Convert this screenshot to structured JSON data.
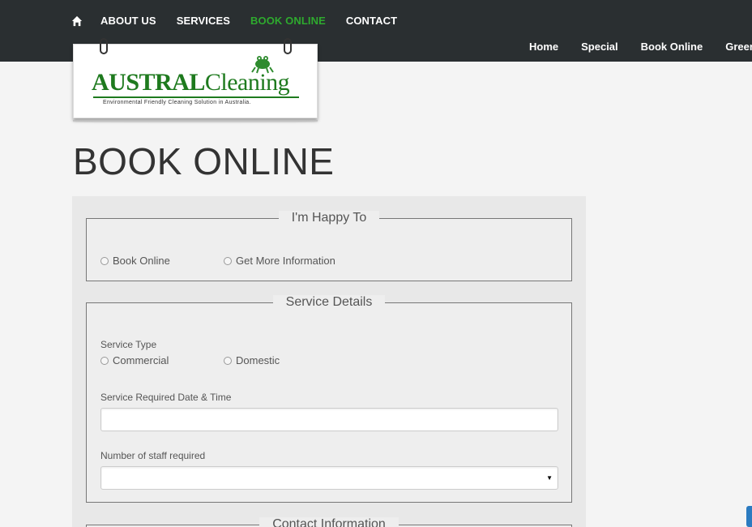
{
  "main_nav": {
    "items": [
      {
        "label": "ABOUT US",
        "active": false
      },
      {
        "label": "SERVICES",
        "active": false
      },
      {
        "label": "BOOK ONLINE",
        "active": true
      },
      {
        "label": "CONTACT",
        "active": false
      }
    ],
    "home_icon": "home-icon"
  },
  "sub_nav": {
    "items": [
      {
        "label": "Home"
      },
      {
        "label": "Special"
      },
      {
        "label": "Book Online"
      },
      {
        "label": "Green"
      }
    ]
  },
  "logo": {
    "brand_bold": "AUSTRAL",
    "brand_light": "Cleaning",
    "tagline": "Environmental Friendly Cleaning Solution in Australia."
  },
  "page": {
    "title": "BOOK ONLINE"
  },
  "form": {
    "happy_to": {
      "legend": "I'm Happy To",
      "options": [
        "Book Online",
        "Get More Information"
      ]
    },
    "service_details": {
      "legend": "Service Details",
      "service_type_label": "Service Type",
      "service_type_options": [
        "Commercial",
        "Domestic"
      ],
      "date_time_label": "Service Required Date & Time",
      "date_time_value": "",
      "staff_label": "Number of staff required",
      "staff_value": ""
    },
    "contact_info": {
      "legend": "Contact Information"
    }
  },
  "colors": {
    "topbar": "#2a2f31",
    "active_nav": "#2eaa2e",
    "brand_green": "#1e7a1e"
  }
}
